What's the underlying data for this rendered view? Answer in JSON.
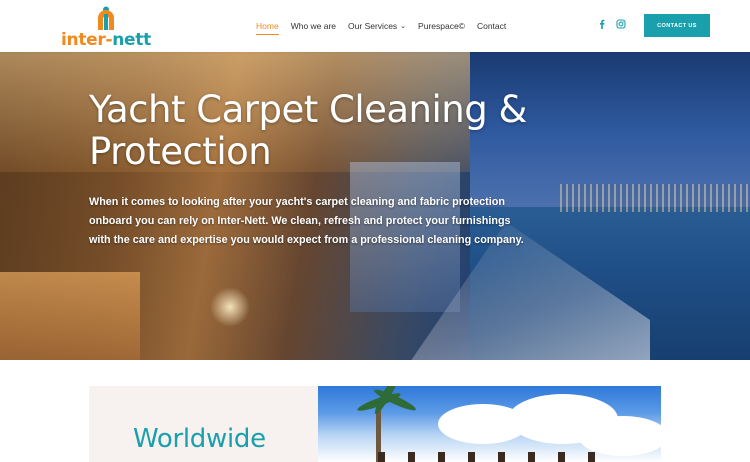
{
  "header": {
    "logo": {
      "text_part1": "inter-",
      "text_part2": "nett"
    },
    "nav": [
      {
        "label": "Home",
        "active": true
      },
      {
        "label": "Who we are",
        "active": false
      },
      {
        "label": "Our Services",
        "active": false,
        "has_dropdown": true
      },
      {
        "label": "Purespace©",
        "active": false
      },
      {
        "label": "Contact",
        "active": false
      }
    ],
    "social": [
      {
        "icon": "facebook-icon"
      },
      {
        "icon": "instagram-icon"
      }
    ],
    "contact_button": "CONTACT US"
  },
  "hero": {
    "title": "Yacht Carpet Cleaning & Protection",
    "body": "When it comes to looking after your yacht's carpet cleaning and fabric protection onboard you can rely on Inter-Nett. We clean, refresh and protect your furnishings with the care and expertise you would expect from a professional cleaning company."
  },
  "section": {
    "heading": "Worldwide"
  },
  "colors": {
    "brand_teal": "#1aa0ad",
    "brand_orange": "#f08a1c"
  }
}
